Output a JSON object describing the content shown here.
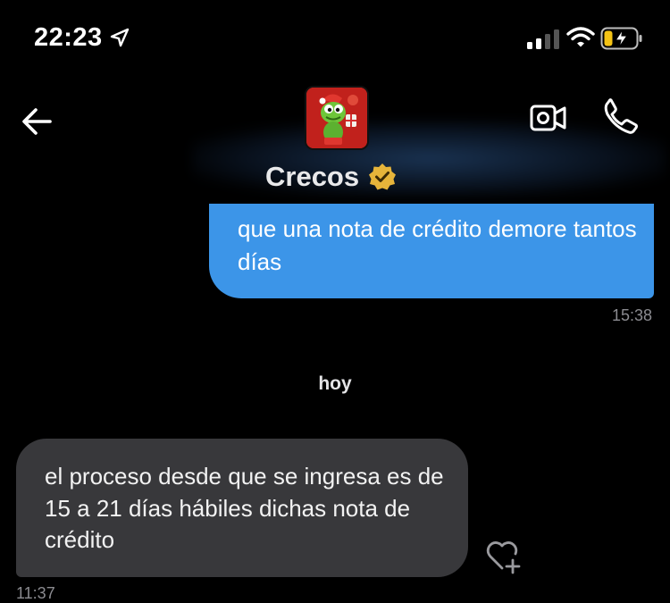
{
  "status_bar": {
    "time": "22:23",
    "signal_bars_active": 2,
    "battery_charging": true
  },
  "header": {
    "contact_name": "Crecos",
    "verified": true,
    "back": "back-arrow-icon",
    "video": "video-camera-icon",
    "call": "phone-icon"
  },
  "messages": [
    {
      "direction": "outgoing",
      "text": "que una nota de crédito demore tantos días",
      "time": "15:38"
    },
    {
      "day_separator": "hoy"
    },
    {
      "direction": "incoming",
      "text": "el proceso  desde que se ingresa es de 15 a 21 días hábiles dichas nota de crédito",
      "time": "11:37"
    }
  ],
  "colors": {
    "outgoing_bubble": "#3c95e8",
    "incoming_bubble": "#38383b",
    "verified_badge": "#e6b43a",
    "background": "#000000"
  }
}
